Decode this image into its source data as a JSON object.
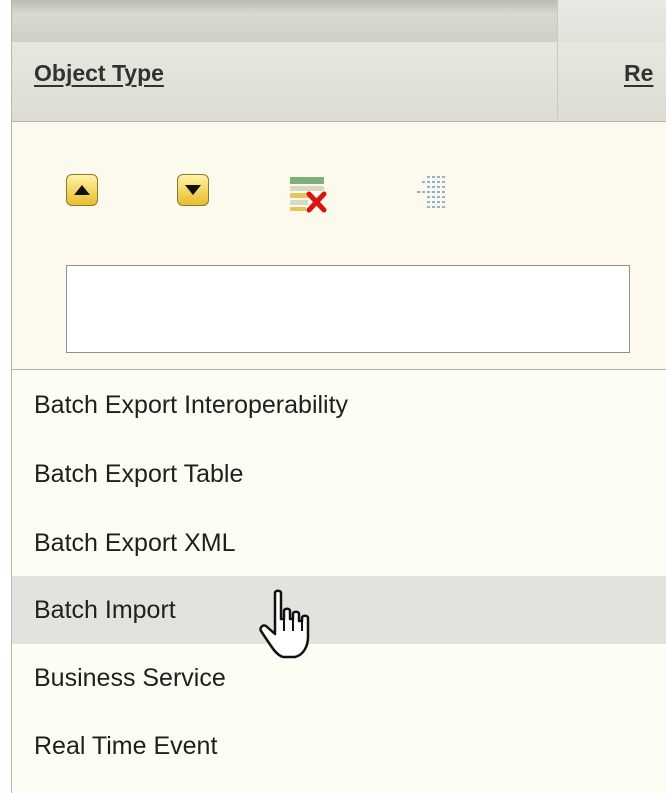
{
  "header": {
    "column_object_type": "Object Type",
    "column_next": "Re"
  },
  "toolbar": {
    "buttons": [
      {
        "icon": "arrow-up-icon"
      },
      {
        "icon": "arrow-down-icon"
      },
      {
        "icon": "clear-filter-icon"
      },
      {
        "icon": "grid-icon"
      }
    ],
    "filter_value": ""
  },
  "list": {
    "items": [
      {
        "label": "Batch Export Interoperability"
      },
      {
        "label": "Batch Export Table"
      },
      {
        "label": "Batch Export XML"
      },
      {
        "label": "Batch Import",
        "hovered": true
      },
      {
        "label": "Business Service"
      },
      {
        "label": "Real Time Event"
      }
    ]
  },
  "colors": {
    "panel_bg": "#fdfdf3",
    "hover_row": "#e3e3dd",
    "button_yellow": "#f3d25a"
  }
}
